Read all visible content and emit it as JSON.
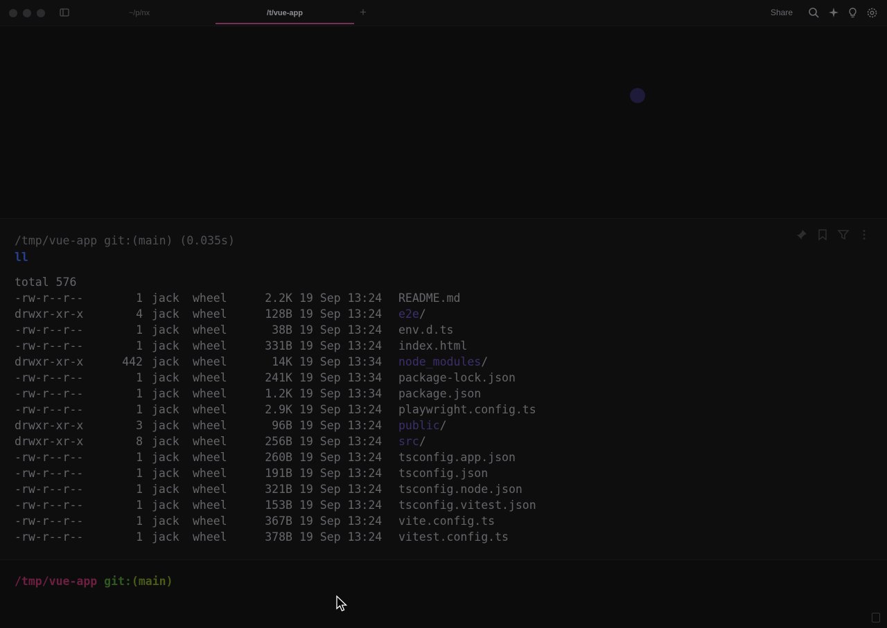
{
  "titlebar": {
    "tabs": [
      {
        "label": "~/p/nx"
      },
      {
        "label": "/t/vue-app"
      }
    ],
    "new_tab_label": "+",
    "share_label": "Share",
    "icons": [
      "sidebar-icon",
      "search-icon",
      "ai-sparkle-icon",
      "lightbulb-icon",
      "gear-icon"
    ]
  },
  "block": {
    "meta": "/tmp/vue-app git:(main) (0.035s)",
    "command": "ll",
    "total": "total 576",
    "rows": [
      {
        "perm": "-rw-r--r--",
        "links": "1",
        "owner": "jack",
        "group": "wheel",
        "size": "2.2K",
        "date": "19 Sep 13:24",
        "name": "README.md",
        "dir": false
      },
      {
        "perm": "drwxr-xr-x",
        "links": "4",
        "owner": "jack",
        "group": "wheel",
        "size": "128B",
        "date": "19 Sep 13:24",
        "name": "e2e",
        "dir": true
      },
      {
        "perm": "-rw-r--r--",
        "links": "1",
        "owner": "jack",
        "group": "wheel",
        "size": "38B",
        "date": "19 Sep 13:24",
        "name": "env.d.ts",
        "dir": false
      },
      {
        "perm": "-rw-r--r--",
        "links": "1",
        "owner": "jack",
        "group": "wheel",
        "size": "331B",
        "date": "19 Sep 13:24",
        "name": "index.html",
        "dir": false
      },
      {
        "perm": "drwxr-xr-x",
        "links": "442",
        "owner": "jack",
        "group": "wheel",
        "size": "14K",
        "date": "19 Sep 13:34",
        "name": "node_modules",
        "dir": true
      },
      {
        "perm": "-rw-r--r--",
        "links": "1",
        "owner": "jack",
        "group": "wheel",
        "size": "241K",
        "date": "19 Sep 13:34",
        "name": "package-lock.json",
        "dir": false
      },
      {
        "perm": "-rw-r--r--",
        "links": "1",
        "owner": "jack",
        "group": "wheel",
        "size": "1.2K",
        "date": "19 Sep 13:34",
        "name": "package.json",
        "dir": false
      },
      {
        "perm": "-rw-r--r--",
        "links": "1",
        "owner": "jack",
        "group": "wheel",
        "size": "2.9K",
        "date": "19 Sep 13:24",
        "name": "playwright.config.ts",
        "dir": false
      },
      {
        "perm": "drwxr-xr-x",
        "links": "3",
        "owner": "jack",
        "group": "wheel",
        "size": "96B",
        "date": "19 Sep 13:24",
        "name": "public",
        "dir": true
      },
      {
        "perm": "drwxr-xr-x",
        "links": "8",
        "owner": "jack",
        "group": "wheel",
        "size": "256B",
        "date": "19 Sep 13:24",
        "name": "src",
        "dir": true
      },
      {
        "perm": "-rw-r--r--",
        "links": "1",
        "owner": "jack",
        "group": "wheel",
        "size": "260B",
        "date": "19 Sep 13:24",
        "name": "tsconfig.app.json",
        "dir": false
      },
      {
        "perm": "-rw-r--r--",
        "links": "1",
        "owner": "jack",
        "group": "wheel",
        "size": "191B",
        "date": "19 Sep 13:24",
        "name": "tsconfig.json",
        "dir": false
      },
      {
        "perm": "-rw-r--r--",
        "links": "1",
        "owner": "jack",
        "group": "wheel",
        "size": "321B",
        "date": "19 Sep 13:24",
        "name": "tsconfig.node.json",
        "dir": false
      },
      {
        "perm": "-rw-r--r--",
        "links": "1",
        "owner": "jack",
        "group": "wheel",
        "size": "153B",
        "date": "19 Sep 13:24",
        "name": "tsconfig.vitest.json",
        "dir": false
      },
      {
        "perm": "-rw-r--r--",
        "links": "1",
        "owner": "jack",
        "group": "wheel",
        "size": "367B",
        "date": "19 Sep 13:24",
        "name": "vite.config.ts",
        "dir": false
      },
      {
        "perm": "-rw-r--r--",
        "links": "1",
        "owner": "jack",
        "group": "wheel",
        "size": "378B",
        "date": "19 Sep 13:24",
        "name": "vitest.config.ts",
        "dir": false
      }
    ],
    "actions": [
      "pin-icon",
      "bookmark-icon",
      "filter-icon",
      "more-icon"
    ]
  },
  "prompt": {
    "path": "/tmp/vue-app",
    "git_label": "git:",
    "branch": "(main)"
  },
  "colors": {
    "tab_active_underline": "#7a2f55",
    "prompt_path": "#6d1f3f",
    "prompt_git": "#2f5a1f",
    "directory": "#3c2f6b",
    "command": "#283f8e"
  }
}
